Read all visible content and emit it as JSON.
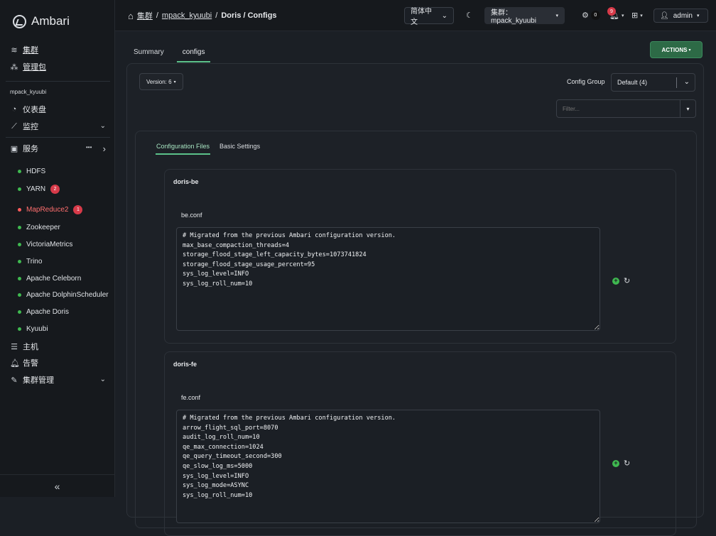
{
  "brand": {
    "name": "Ambari"
  },
  "sidebar": {
    "top_items": [
      {
        "label": "集群",
        "icon": "layers-icon"
      },
      {
        "label": "管理包",
        "icon": "packages-icon"
      }
    ],
    "cluster_name": "mpack_kyuubi",
    "items": [
      {
        "label": "仪表盘",
        "icon": "dashboard-icon"
      },
      {
        "label": "监控",
        "icon": "chart-icon"
      },
      {
        "label": "服务",
        "icon": "briefcase-icon",
        "more": "•••"
      }
    ],
    "services": [
      {
        "label": "HDFS",
        "badge": ""
      },
      {
        "label": "YARN",
        "badge": "2"
      },
      {
        "label": "MapReduce2",
        "badge": "1"
      },
      {
        "label": "Zookeeper",
        "badge": ""
      },
      {
        "label": "VictoriaMetrics",
        "badge": ""
      },
      {
        "label": "Trino",
        "badge": ""
      },
      {
        "label": "Apache Celeborn",
        "badge": ""
      },
      {
        "label": "Apache DolphinScheduler",
        "badge": ""
      },
      {
        "label": "Apache Doris",
        "badge": ""
      },
      {
        "label": "Kyuubi",
        "badge": ""
      }
    ],
    "bottom_items": [
      {
        "label": "主机",
        "icon": "server-icon"
      },
      {
        "label": "告警",
        "icon": "bell-icon"
      },
      {
        "label": "集群管理",
        "icon": "wrench-icon"
      }
    ],
    "collapse_glyph": "«"
  },
  "topbar": {
    "breadcrumb": {
      "home": "集群",
      "cluster": "mpack_kyuubi",
      "current": "Doris / Configs"
    },
    "language": "简体中文",
    "cluster_selector": "集群：mpack_kyuubi",
    "ops_count": "0",
    "alerts_count": "9",
    "user": "admin"
  },
  "main": {
    "tabs": [
      {
        "label": "Summary"
      },
      {
        "label": "configs"
      }
    ],
    "actions_label": "ACTIONS",
    "version_label": "Version: 6",
    "config_group_label": "Config Group",
    "config_group_value": "Default (4)",
    "filter_placeholder": "Filter...",
    "subtabs": [
      {
        "label": "Configuration Files"
      },
      {
        "label": "Basic Settings"
      }
    ],
    "sections": [
      {
        "title": "doris-be",
        "file": "be.conf",
        "content": "# Migrated from the previous Ambari configuration version.\nmax_base_compaction_threads=4\nstorage_flood_stage_left_capacity_bytes=1073741824\nstorage_flood_stage_usage_percent=95\nsys_log_level=INFO\nsys_log_roll_num=10"
      },
      {
        "title": "doris-fe",
        "file": "fe.conf",
        "content": "# Migrated from the previous Ambari configuration version.\narrow_flight_sql_port=8070\naudit_log_roll_num=10\nqe_max_connection=1024\nqe_query_timeout_second=300\nqe_slow_log_ms=5000\nsys_log_level=INFO\nsys_log_mode=ASYNC\nsys_log_roll_num=10"
      }
    ]
  }
}
